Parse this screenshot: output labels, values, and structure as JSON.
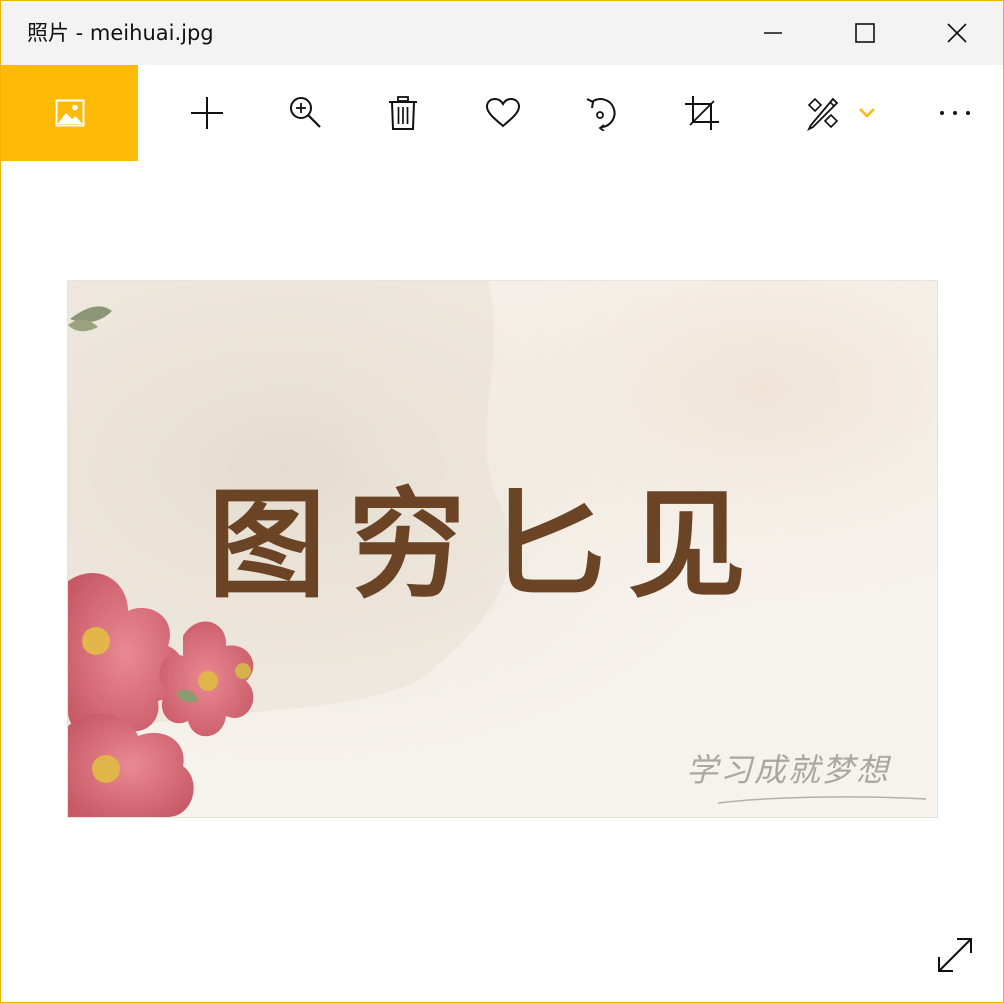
{
  "window": {
    "title": "照片 - meihuai.jpg",
    "accent_color": "#ffba08",
    "border_color": "#f0b400"
  },
  "title_controls": [
    {
      "name": "minimize-button",
      "icon": "minimize-icon"
    },
    {
      "name": "maximize-button",
      "icon": "maximize-icon"
    },
    {
      "name": "close-button",
      "icon": "close-icon"
    }
  ],
  "toolbar": {
    "items": [
      {
        "name": "collection-button",
        "icon": "photos-icon"
      },
      {
        "name": "add-to-button",
        "icon": "plus-icon"
      },
      {
        "name": "zoom-button",
        "icon": "zoom-in-icon"
      },
      {
        "name": "delete-button",
        "icon": "trash-icon"
      },
      {
        "name": "favorite-button",
        "icon": "heart-icon"
      },
      {
        "name": "rotate-button",
        "icon": "rotate-icon"
      },
      {
        "name": "crop-button",
        "icon": "crop-icon"
      },
      {
        "name": "edit-create-button",
        "icon": "edit-pencil-icon"
      },
      {
        "name": "edit-dropdown-button",
        "icon": "chevron-down-icon"
      },
      {
        "name": "more-button",
        "icon": "ellipsis-icon"
      }
    ]
  },
  "photo": {
    "file_name": "meihuai.jpg",
    "headline": "图穷匕见",
    "signature": "学习成就梦想",
    "ink_color": "#6b4425"
  },
  "fullscreen": {
    "icon": "expand-icon"
  }
}
